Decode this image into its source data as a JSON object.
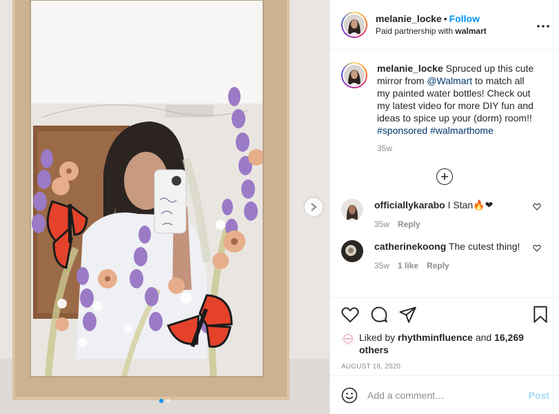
{
  "header": {
    "username": "melanie_locke",
    "separator": "•",
    "follow_label": "Follow",
    "sub_prefix": "Paid partnership with",
    "partner": "walmart",
    "more_icon": "more-options-icon"
  },
  "caption": {
    "username": "melanie_locke",
    "text_1": "Spruced up this cute mirror from",
    "mention": "@Walmart",
    "text_2": "to match all my painted water bottles! Check out my latest video for more DIY fun and ideas to spice up your (dorm) room!!",
    "hashtag_1": "#sponsored",
    "hashtag_2": "#walmarthome",
    "age": "35w"
  },
  "comments": [
    {
      "username": "officiallykarabo",
      "text": "I Stan",
      "emoji": "🔥❤",
      "age": "35w",
      "likes": "",
      "reply_label": "Reply"
    },
    {
      "username": "catherinekoong",
      "text": "The cutest thing!",
      "emoji": "",
      "age": "35w",
      "likes": "1 like",
      "reply_label": "Reply"
    }
  ],
  "likes": {
    "prefix": "Liked by",
    "user": "rhythminfluence",
    "joiner": "and",
    "others": "16,269 others"
  },
  "date": "AUGUST 18, 2020",
  "add_comment": {
    "placeholder": "Add a comment…",
    "post_label": "Post"
  },
  "carousel": {
    "current": 1,
    "total": 2
  },
  "colors": {
    "accent": "#0095f6",
    "text": "#262626",
    "muted": "#8e8e8e",
    "border": "#efefef"
  }
}
